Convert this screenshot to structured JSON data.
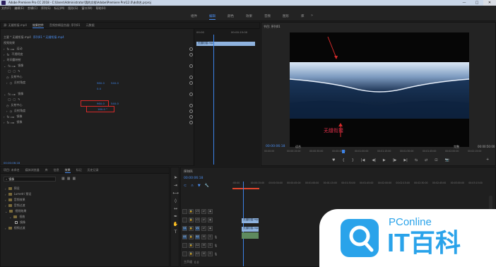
{
  "titlebar": {
    "title": "Adobe Premiere Pro CC 2018 - C:\\Users\\Administrator\\我的文档\\Adobe\\Premiere Pro\\12.0\\未命名.prproj",
    "minimize": "—",
    "maximize": "□",
    "close": "✕"
  },
  "menu": [
    "文件(F)",
    "编辑(E)",
    "剪辑(C)",
    "序列(S)",
    "标记(M)",
    "图形(G)",
    "窗口(W)",
    "帮助(H)"
  ],
  "workspaces": [
    "组件",
    "编辑",
    "颜色",
    "效果",
    "音频",
    "图形",
    "库"
  ],
  "workspace_active": "编辑",
  "effects_panel": {
    "tabs": [
      "源: 无缝衔接.mp4",
      "效果控件",
      "音频剪辑混合器: 序列01",
      "元数据"
    ],
    "source_row": "主要 * 无缝衔接.mp4",
    "seq_row": "序列01 * 无缝衔接.mp4",
    "section_video": "视频效果",
    "motion": "运动",
    "opacity": "不透明度",
    "timeremap": "时间重映射",
    "mirror1": "镜像",
    "center1": "反射中心",
    "angle1": "反射角度",
    "mirror2": "镜像",
    "center2": "反射中心",
    "angle2": "反射角度",
    "mirror3": "镜像",
    "mirror4": "镜像",
    "val_center1_x": "960.0",
    "val_center1_y": "540.0",
    "val_angle1": "0.0",
    "val_center2_x": "960.0",
    "val_center2_y": "540.0",
    "val_angle2": "180.0 °",
    "timecode": "00:00:06:18",
    "ruler_left": "00:00",
    "ruler_right": "00:00:15:00",
    "clip_label": "无缝衔接.mp4"
  },
  "program_monitor": {
    "tab": "节目: 序列01",
    "caption": "无缝衔接",
    "timecode": "00:00:06:18",
    "fit": "适合",
    "quality": "完整",
    "duration": "00:00:50:00",
    "ruler_labels": [
      "00:00:00",
      "00:00:15:00",
      "00:00:30:00",
      "00:00:45:00",
      "00:01:00:00",
      "00:01:15:00",
      "00:01:30:00",
      "00:01:45:00",
      "00:02:00:00",
      "00:02:15:00"
    ],
    "controls": [
      "♥",
      "{",
      "}",
      "|◀",
      "◀|",
      "▶",
      "|▶",
      "▶|",
      "⇆",
      "⇄",
      "⊡",
      "📷",
      "+"
    ]
  },
  "project_panel": {
    "tabs": [
      "项目: 未命名",
      "媒体浏览器",
      "库",
      "信息",
      "效果",
      "标记",
      "历史记录"
    ],
    "search_value": "镜像",
    "items": [
      "预设",
      "Lumetri 预设",
      "音频效果",
      "音频过渡",
      "视频效果",
      "扭曲",
      "镜像",
      "视频过渡"
    ]
  },
  "timeline": {
    "tab": "序列01",
    "timecode": "00:00:06:18",
    "ruler_labels": [
      ":00:00",
      "00:00:15:00",
      "00:00:30:00",
      "00:00:45:00",
      "00:01:00:00",
      "00:01:15:00",
      "00:01:30:00",
      "00:01:45:00",
      "00:02:00:00",
      "00:02:15:00",
      "00:02:30:00",
      "00:02:45:00",
      "00:03:00:00",
      "00:03:15:00"
    ],
    "tracks": [
      "V3",
      "V2",
      "V1",
      "A1",
      "A2",
      "A3"
    ],
    "master": "主声道",
    "master_val": "0.0",
    "clip_v": "无缝衔接.mp4",
    "clip_v1": "无缝衔接.mp4 [V]"
  },
  "watermark": {
    "brand": "PConline",
    "name": "IT百科"
  }
}
